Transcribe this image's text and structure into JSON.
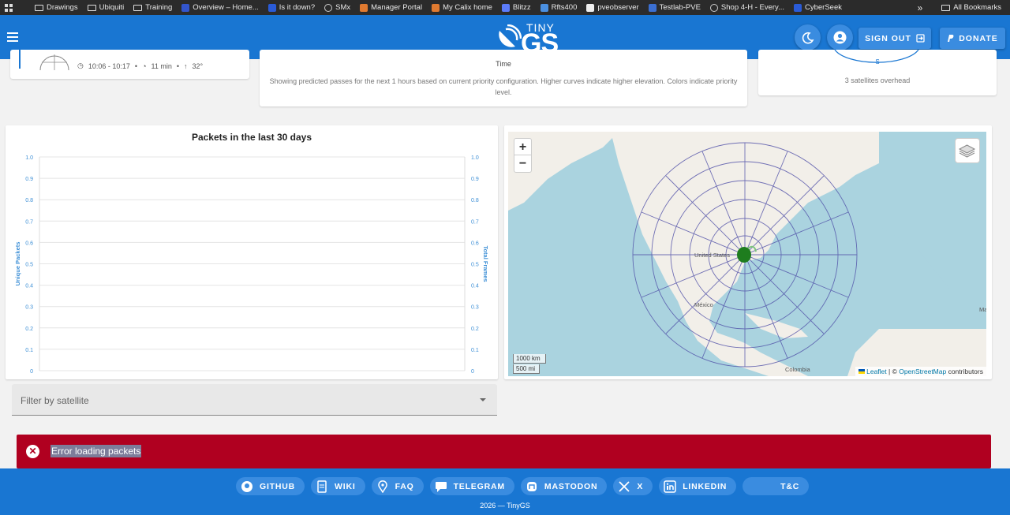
{
  "bookmarks": [
    {
      "icon": "folder-icon",
      "label": "Drawings"
    },
    {
      "icon": "folder-icon",
      "label": "Ubiquiti"
    },
    {
      "icon": "folder-icon",
      "label": "Training"
    },
    {
      "icon": "site-icon",
      "label": "Overview – Home..."
    },
    {
      "icon": "site-icon",
      "label": "Is it down?"
    },
    {
      "icon": "globe-icon",
      "label": "SMx"
    },
    {
      "icon": "site-icon",
      "label": "Manager Portal"
    },
    {
      "icon": "site-icon",
      "label": "My Calix home"
    },
    {
      "icon": "site-icon",
      "label": "Blitzz"
    },
    {
      "icon": "site-icon",
      "label": "Rfts400"
    },
    {
      "icon": "site-icon",
      "label": "pveobserver"
    },
    {
      "icon": "site-icon",
      "label": "Testlab-PVE"
    },
    {
      "icon": "globe-icon",
      "label": "Shop 4-H - Every..."
    },
    {
      "icon": "site-icon",
      "label": "CyberSeek"
    }
  ],
  "bookmarks_more": "»",
  "all_bookmarks": "All Bookmarks",
  "header": {
    "logo_top": "TINY",
    "logo_main": "GS",
    "signout_label": "SIGN OUT",
    "donate_label": "DONATE",
    "brand_color": "#1976d2"
  },
  "pass": {
    "time_range": "10:06 - 10:17",
    "duration": "11 min",
    "elevation": "32°"
  },
  "predict": {
    "axis_label": "Time",
    "note": "Showing predicted passes for the next 1 hours based on current priority configuration. Higher curves indicate higher elevation. Colors indicate priority level."
  },
  "overhead": {
    "marker": "S",
    "text": "3 satellites overhead"
  },
  "chart_data": {
    "type": "line",
    "title": "Packets in the last 30 days",
    "ylabel": "Unique Packets",
    "y2label": "Total Frames",
    "ylim": [
      0,
      1
    ],
    "y2lim": [
      0,
      1
    ],
    "yticks": [
      "0",
      "0.1",
      "0.2",
      "0.3",
      "0.4",
      "0.5",
      "0.6",
      "0.7",
      "0.8",
      "0.9",
      "1.0"
    ],
    "series": [],
    "grid": true
  },
  "map": {
    "zoom_in": "+",
    "zoom_out": "−",
    "scale_km": "1000 km",
    "scale_mi": "500 mi",
    "label_us": "United States",
    "label_mexico": "México",
    "label_colombia": "Colombia",
    "label_edge": "Ma",
    "attribution_leaflet": "Leaflet",
    "attribution_sep": " | © ",
    "attribution_osm": "OpenStreetMap",
    "attribution_tail": " contributors"
  },
  "filter": {
    "label": "Filter by satellite"
  },
  "error": {
    "message": "Error loading packets",
    "color": "#b00020"
  },
  "footer": {
    "links": [
      {
        "icon": "github-icon",
        "label": "GITHUB"
      },
      {
        "icon": "wiki-icon",
        "label": "WIKI"
      },
      {
        "icon": "location-icon",
        "label": "FAQ"
      },
      {
        "icon": "chat-icon",
        "label": "TELEGRAM"
      },
      {
        "icon": "mastodon-icon",
        "label": "MASTODON"
      },
      {
        "icon": "x-icon",
        "label": "X"
      },
      {
        "icon": "linkedin-icon",
        "label": "LINKEDIN"
      },
      {
        "icon": "",
        "label": "T&C"
      }
    ],
    "copyright": "2026 — TinyGS"
  }
}
